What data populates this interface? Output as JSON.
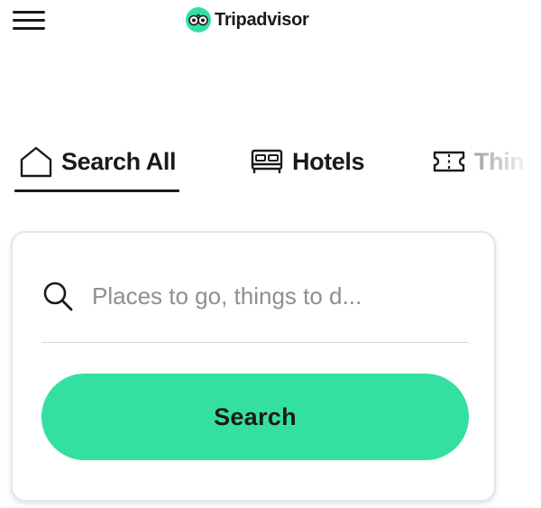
{
  "header": {
    "menu_icon": "hamburger-menu-icon",
    "brand_name": "Tripadvisor",
    "brand_logo_icon": "owl-logo-icon",
    "brand_color": "#34e0a1"
  },
  "tabs": [
    {
      "label": "Search All",
      "icon": "home-icon",
      "active": true
    },
    {
      "label": "Hotels",
      "icon": "bed-icon",
      "active": false
    },
    {
      "label": "Thin",
      "icon": "ticket-icon",
      "active": false
    }
  ],
  "search": {
    "icon": "search-icon",
    "placeholder": "Places to go, things to d...",
    "value": "",
    "button_label": "Search",
    "button_color": "#34e0a1"
  }
}
